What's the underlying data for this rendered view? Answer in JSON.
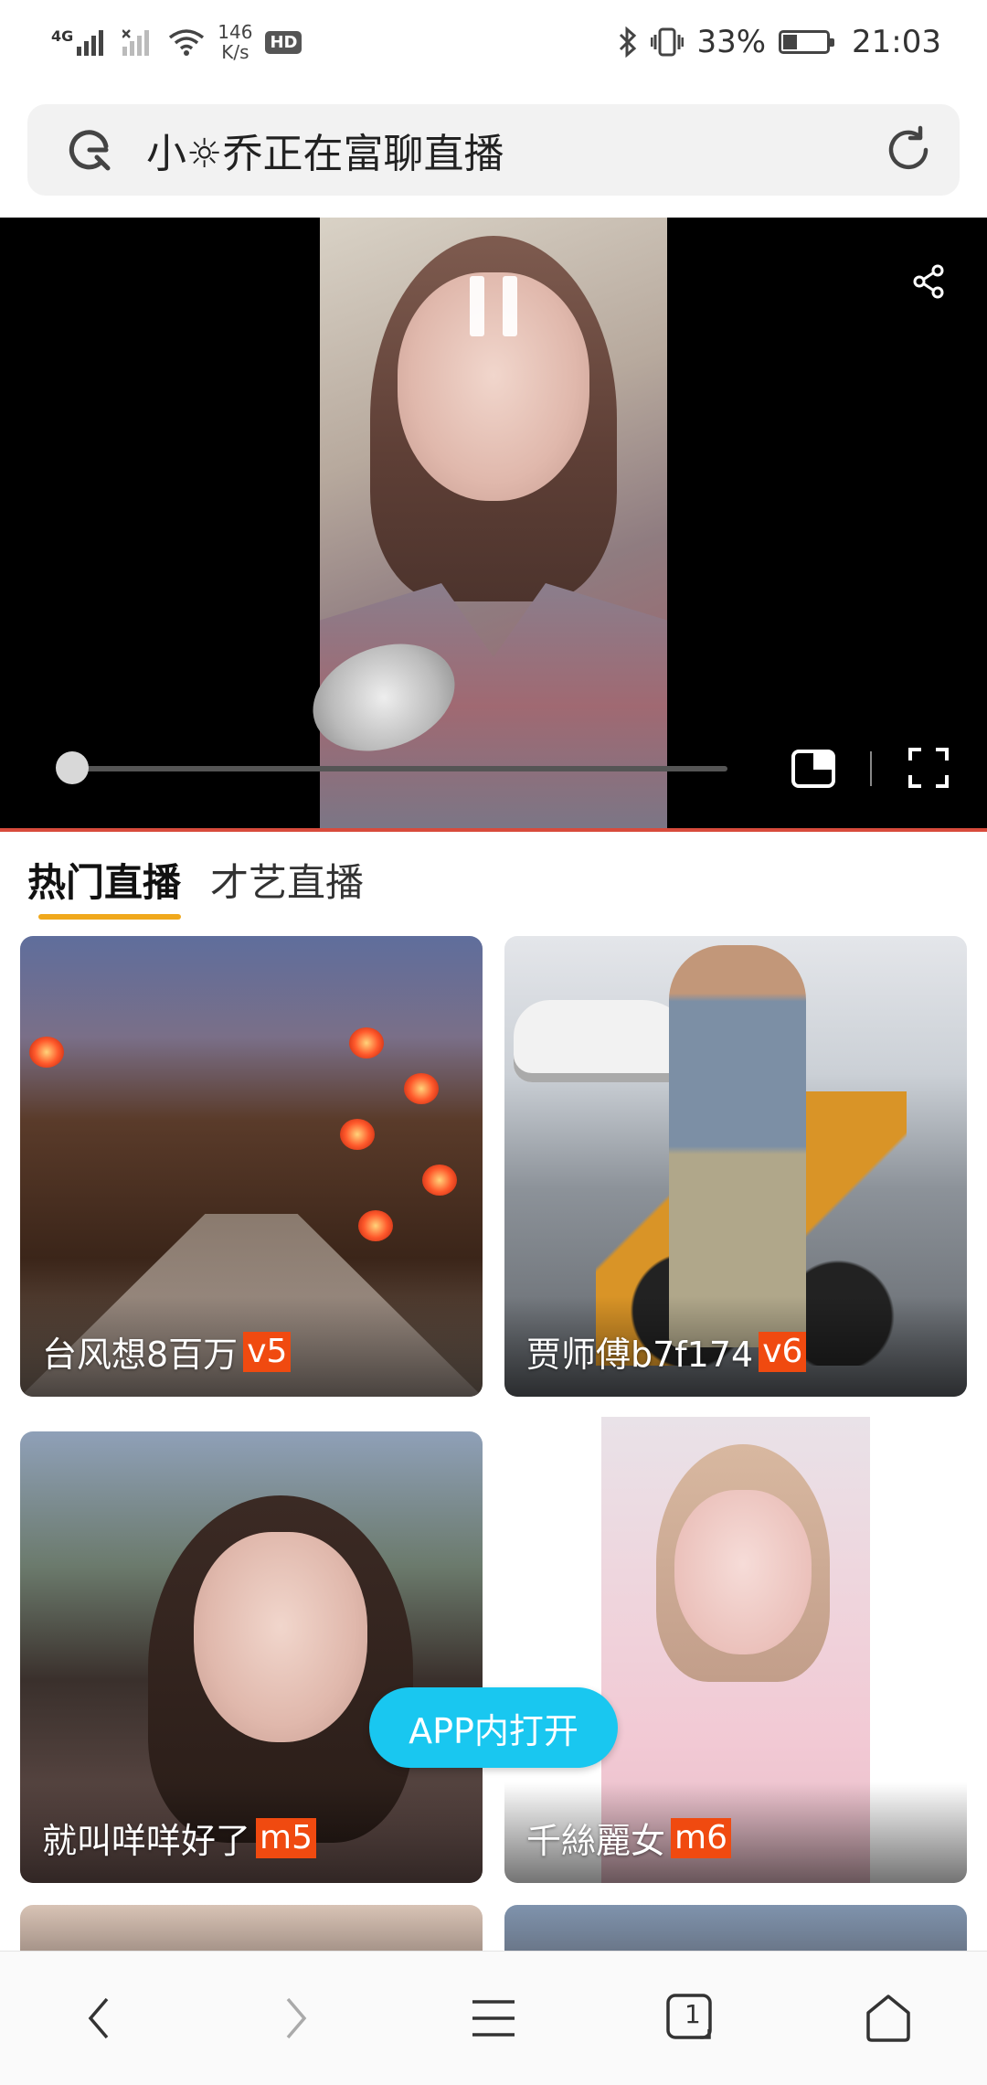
{
  "status_bar": {
    "network": "4G",
    "net_speed_value": "146",
    "net_speed_unit": "K/s",
    "hd_badge": "HD",
    "battery_percent": "33%",
    "battery_level": 0.33,
    "time": "21:03"
  },
  "address_bar": {
    "text": "小☼乔正在富聊直播",
    "engine_icon": "google-lens-icon",
    "action_icon": "reload-icon"
  },
  "video": {
    "state_icon": "pause-icon",
    "progress": 0.02
  },
  "tabs": [
    {
      "label": "热门直播",
      "active": true
    },
    {
      "label": "才艺直播",
      "active": false
    }
  ],
  "cards": [
    {
      "name": "台风想8百万",
      "level": "v5"
    },
    {
      "name": "贾师傅b7f174",
      "level": "v6"
    },
    {
      "name": "就叫咩咩好了",
      "level": "m5"
    },
    {
      "name": "千絲麗女",
      "level": "m6"
    }
  ],
  "app_open_button": "APP内打开",
  "bottom_nav": {
    "tab_count": "1"
  },
  "colors": {
    "accent_underline": "#f0a81c",
    "level_badge": "#f04a10",
    "app_button": "#19c7f0"
  }
}
